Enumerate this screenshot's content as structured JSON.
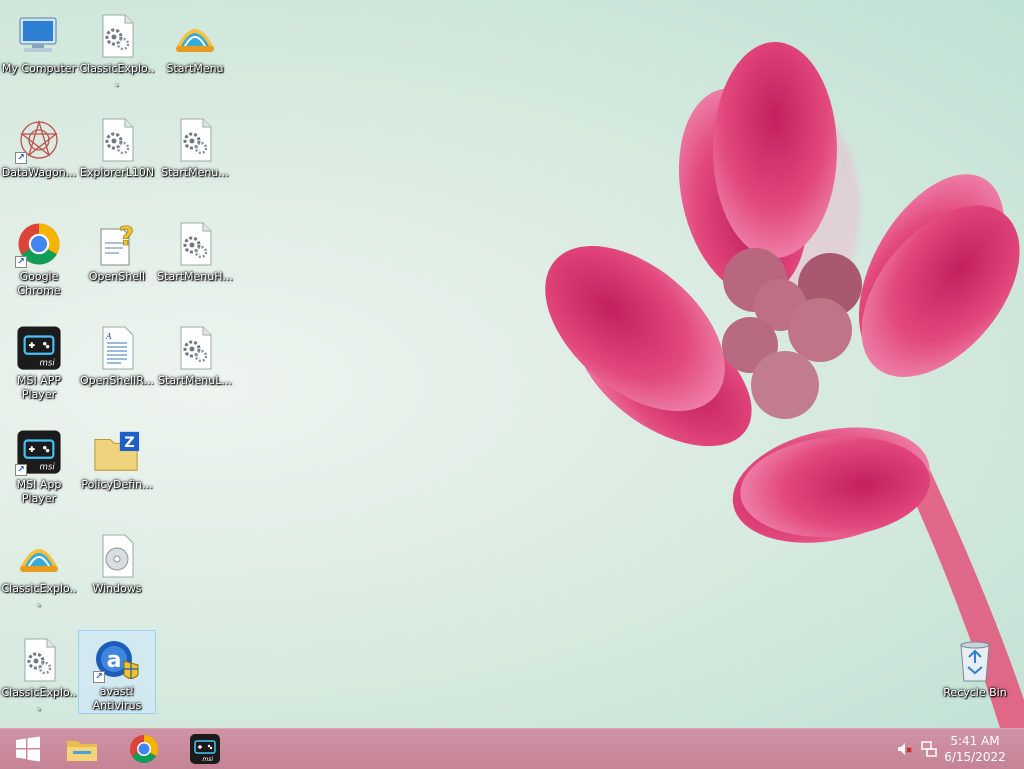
{
  "desktop": {
    "icons": [
      {
        "name": "My Computer",
        "glyph": "computer-icon"
      },
      {
        "name": "ClassicExplo...",
        "glyph": "settings-file-icon"
      },
      {
        "name": "StartMenu",
        "glyph": "shell-icon"
      },
      {
        "name": "DataWagon...",
        "glyph": "datawagon-icon"
      },
      {
        "name": "ExplorerL10N",
        "glyph": "settings-file-icon"
      },
      {
        "name": "StartMenu...",
        "glyph": "settings-file-icon"
      },
      {
        "name": "Google Chrome",
        "glyph": "chrome-icon"
      },
      {
        "name": "OpenShell",
        "glyph": "help-file-icon"
      },
      {
        "name": "StartMenuH...",
        "glyph": "settings-file-icon"
      },
      {
        "name": "MSI APP Player",
        "glyph": "msi-icon"
      },
      {
        "name": "OpenShellR...",
        "glyph": "document-icon"
      },
      {
        "name": "StartMenuL...",
        "glyph": "settings-file-icon"
      },
      {
        "name": "MSI App Player",
        "glyph": "msi-icon"
      },
      {
        "name": "PolicyDefin...",
        "glyph": "zip-folder-icon"
      },
      {
        "name": "ClassicExplo...",
        "glyph": "shell-icon"
      },
      {
        "name": "Windows",
        "glyph": "disc-image-icon"
      },
      {
        "name": "ClassicExplo...",
        "glyph": "settings-file-icon"
      },
      {
        "name": "avast! Antivirus",
        "glyph": "avast-icon"
      },
      {
        "name": "Recycle Bin",
        "glyph": "recycle-bin-icon"
      }
    ]
  },
  "taskbar": {
    "pinned": [
      "start-button",
      "file-explorer",
      "google-chrome",
      "msi-app-player"
    ],
    "tray": {
      "icons": [
        "volume-muted-icon",
        "network-icon"
      ]
    },
    "clock": {
      "time": "5:41 AM",
      "date": "6/15/2022"
    }
  },
  "colors": {
    "taskbar": "#c58496",
    "petal": "#e2487d",
    "selection": "#99d1ff"
  }
}
